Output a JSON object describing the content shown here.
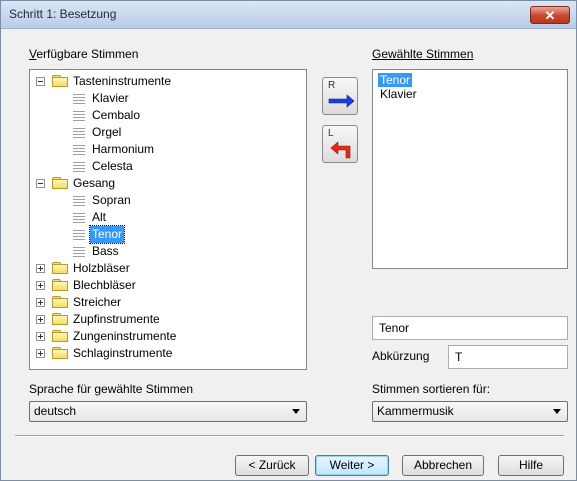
{
  "window": {
    "title": "Schritt 1: Besetzung",
    "close_label": "✕"
  },
  "available": {
    "label": "Verfügbare Stimmen",
    "underline_char": "V",
    "groups": [
      {
        "label": "Tasteninstrumente",
        "expanded": true,
        "children": [
          "Klavier",
          "Cembalo",
          "Orgel",
          "Harmonium",
          "Celesta"
        ]
      },
      {
        "label": "Gesang",
        "expanded": true,
        "children": [
          "Sopran",
          "Alt",
          "Tenor",
          "Bass"
        ],
        "selected_child": "Tenor"
      },
      {
        "label": "Holzbläser",
        "expanded": false
      },
      {
        "label": "Blechbläser",
        "expanded": false
      },
      {
        "label": "Streicher",
        "expanded": false
      },
      {
        "label": "Zupfinstrumente",
        "expanded": false
      },
      {
        "label": "Zungeninstrumente",
        "expanded": false
      },
      {
        "label": "Schlaginstrumente",
        "expanded": false
      }
    ]
  },
  "transfer": {
    "add_key": "R",
    "remove_key": "L"
  },
  "selected": {
    "label": "Gewählte Stimmen",
    "items": [
      "Tenor",
      "Klavier"
    ],
    "selected_item": "Tenor"
  },
  "name_field": {
    "value": "Tenor"
  },
  "abbrev": {
    "label": "Abkürzung",
    "value": "T"
  },
  "language": {
    "label": "Sprache für gewählte Stimmen",
    "value": "deutsch"
  },
  "sort": {
    "label": "Stimmen sortieren für:",
    "value": "Kammermusik"
  },
  "buttons": {
    "back": "< Zurück",
    "next": "Weiter >",
    "cancel": "Abbrechen",
    "help": "Hilfe"
  },
  "colors": {
    "selection": "#3399ff",
    "arrow_right": "#1a3fe0",
    "arrow_left": "#e22a1c"
  }
}
